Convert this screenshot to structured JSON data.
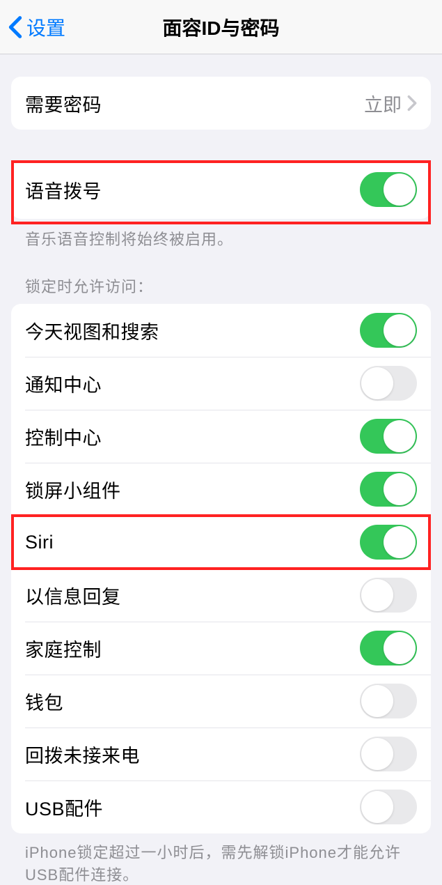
{
  "nav": {
    "back_label": "设置",
    "title": "面容ID与密码"
  },
  "group1": {
    "require_passcode_label": "需要密码",
    "require_passcode_value": "立即"
  },
  "group2": {
    "voice_dial_label": "语音拨号",
    "voice_dial_on": true,
    "footer": "音乐语音控制将始终被启用。"
  },
  "group3": {
    "header": "锁定时允许访问：",
    "items": [
      {
        "label": "今天视图和搜索",
        "on": true
      },
      {
        "label": "通知中心",
        "on": false
      },
      {
        "label": "控制中心",
        "on": true
      },
      {
        "label": "锁屏小组件",
        "on": true
      },
      {
        "label": "Siri",
        "on": true
      },
      {
        "label": "以信息回复",
        "on": false
      },
      {
        "label": "家庭控制",
        "on": true
      },
      {
        "label": "钱包",
        "on": false
      },
      {
        "label": "回拨未接来电",
        "on": false
      },
      {
        "label": "USB配件",
        "on": false
      }
    ],
    "footer": "iPhone锁定超过一小时后，需先解锁iPhone才能允许USB配件连接。"
  }
}
